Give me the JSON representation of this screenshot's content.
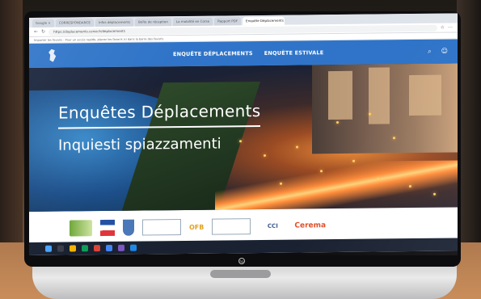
{
  "browser": {
    "tabs": [
      {
        "label": "Google ×"
      },
      {
        "label": "CORRESPONDANCE"
      },
      {
        "label": "Infos déplacements"
      },
      {
        "label": "Boîte de réception"
      },
      {
        "label": "La mobilité en Corse"
      },
      {
        "label": "Rapport PDF"
      },
      {
        "label": "Enquête Déplacements",
        "active": true
      }
    ],
    "url": "https://deplacements.corse.fr/deplacements",
    "bookmark_hint": "Importer les favoris · Pour un accès rapide, placez les favoris ici dans la barre des favoris"
  },
  "site": {
    "nav": {
      "items": [
        "ENQUÊTE DÉPLACEMENTS",
        "ENQUÊTE ESTIVALE"
      ],
      "search_icon": "search-icon",
      "user_icon": "user-icon"
    },
    "hero": {
      "title": "Enquêtes Déplacements",
      "subtitle": "Inquiesti spiazzamenti"
    },
    "partners": {
      "ofb": "OFB",
      "cci": "CCI",
      "cerema": "Cerema"
    }
  },
  "colors": {
    "nav_blue": "#2f74c8",
    "cerema_orange": "#e0502a"
  },
  "device": {
    "brand": "hp"
  }
}
